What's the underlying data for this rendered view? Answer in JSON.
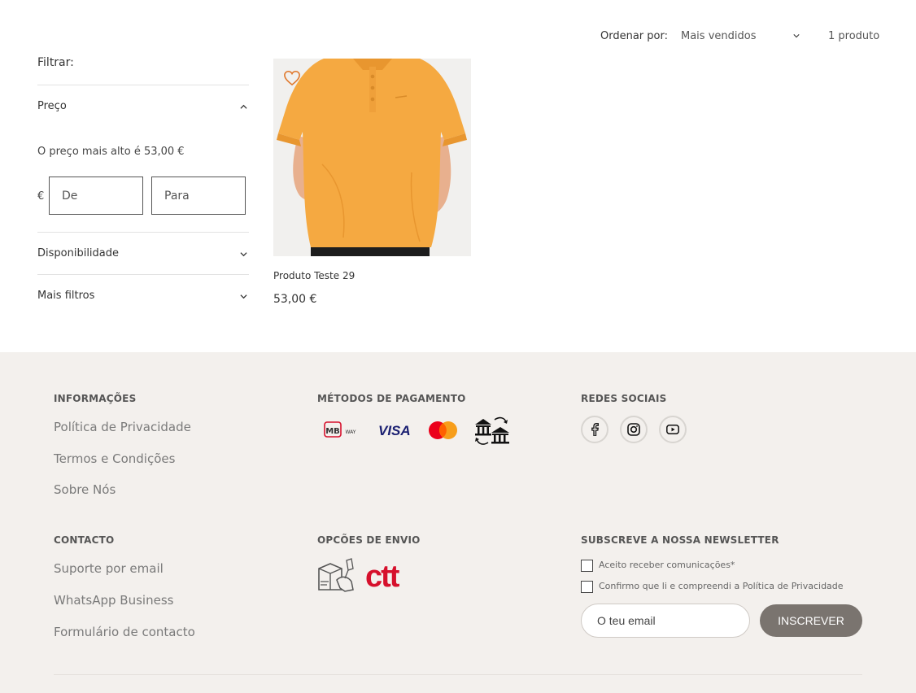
{
  "toolbar": {
    "sort_label": "Ordenar por:",
    "sort_value": "Mais vendidos",
    "product_count": "1 produto"
  },
  "filters": {
    "title": "Filtrar:",
    "price": {
      "label": "Preço",
      "highest_note": "O preço mais alto é 53,00 €",
      "currency": "€",
      "from_placeholder": "De",
      "to_placeholder": "Para"
    },
    "availability_label": "Disponibilidade",
    "more_filters_label": "Mais filtros"
  },
  "product": {
    "title": "Produto Teste 29",
    "price": "53,00 €",
    "image": "orange-polo-shirt",
    "shirt_color": "#f5a941"
  },
  "footer": {
    "info": {
      "heading": "INFORMAÇÕES",
      "links": [
        "Política de Privacidade",
        "Termos e Condições",
        "Sobre Nós"
      ]
    },
    "payment": {
      "heading": "MÉTODOS DE PAGAMENTO",
      "methods": [
        "mb-way",
        "visa",
        "mastercard",
        "bank-transfer"
      ],
      "mbway_text": "MB",
      "mbway_sub": "WAY",
      "visa_text": "VISA"
    },
    "social": {
      "heading": "REDES SOCIAIS",
      "networks": [
        "facebook",
        "instagram",
        "youtube"
      ]
    },
    "contact": {
      "heading": "CONTACTO",
      "links": [
        "Suporte por email",
        "WhatsApp Business",
        "Formulário de contacto"
      ]
    },
    "shipping": {
      "heading": "OPCÕES DE ENVIO",
      "carrier_logo": "ctt",
      "carrier_color": "#d6102c"
    },
    "newsletter": {
      "heading": "SUBSCREVE A NOSSA NEWSLETTER",
      "consent_1": "Aceito receber comunicações*",
      "consent_2": "Confirmo que li e compreendi a Política de Privacidade",
      "email_placeholder": "O teu email",
      "button_label": "INSCREVER"
    }
  }
}
